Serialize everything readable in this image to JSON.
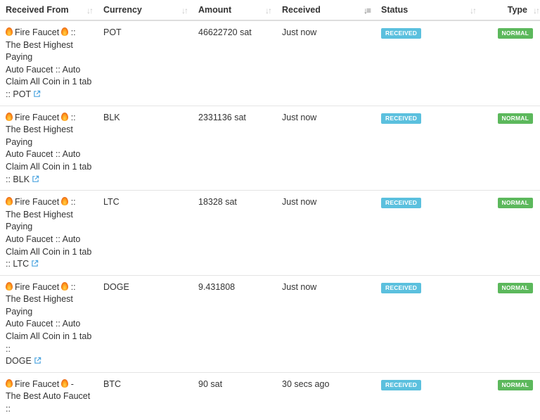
{
  "headers": {
    "from": "Received From",
    "currency": "Currency",
    "amount": "Amount",
    "received": "Received",
    "status": "Status",
    "type": "Type"
  },
  "rows": [
    {
      "from_line1": "Fire Faucet",
      "from_sep": "::",
      "from_rest": [
        "The Best Highest",
        "Paying",
        "Auto Faucet :: Auto",
        "Claim All Coin in 1 tab"
      ],
      "from_last": ":: POT",
      "currency": "POT",
      "amount": "46622720 sat",
      "received": "Just now",
      "status": "RECEIVED",
      "type": "NORMAL"
    },
    {
      "from_line1": "Fire Faucet",
      "from_sep": "::",
      "from_rest": [
        "The Best Highest",
        "Paying",
        "Auto Faucet :: Auto",
        "Claim All Coin in 1 tab"
      ],
      "from_last": ":: BLK",
      "currency": "BLK",
      "amount": "2331136 sat",
      "received": "Just now",
      "status": "RECEIVED",
      "type": "NORMAL"
    },
    {
      "from_line1": "Fire Faucet",
      "from_sep": "::",
      "from_rest": [
        "The Best Highest",
        "Paying",
        "Auto Faucet :: Auto",
        "Claim All Coin in 1 tab"
      ],
      "from_last": ":: LTC",
      "currency": "LTC",
      "amount": "18328 sat",
      "received": "Just now",
      "status": "RECEIVED",
      "type": "NORMAL"
    },
    {
      "from_line1": "Fire Faucet",
      "from_sep": "::",
      "from_rest": [
        "The Best Highest",
        "Paying",
        "Auto Faucet :: Auto",
        "Claim All Coin in 1 tab",
        "::"
      ],
      "from_last": "DOGE",
      "currency": "DOGE",
      "amount": "9.431808",
      "received": "Just now",
      "status": "RECEIVED",
      "type": "NORMAL"
    },
    {
      "from_line1": "Fire Faucet",
      "from_sep": "-",
      "from_rest": [
        "The Best Auto Faucet",
        "::"
      ],
      "from_last": "",
      "currency": "BTC",
      "amount": "90 sat",
      "received": "30 secs ago",
      "status": "RECEIVED",
      "type": "NORMAL"
    }
  ],
  "colors": {
    "status_label": "#5bc0de",
    "type_label": "#5cb85c",
    "link_icon": "#4aa3df"
  },
  "icons": {
    "fire": "fire-emoji-icon",
    "external": "external-link-icon",
    "sort": "sort-icon"
  }
}
